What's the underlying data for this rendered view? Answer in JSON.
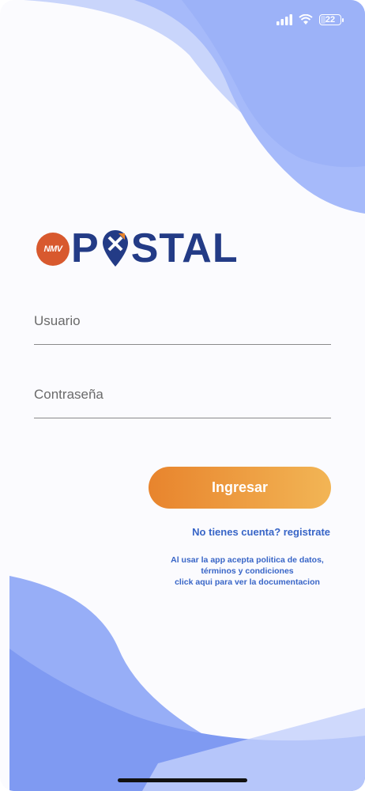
{
  "status_bar": {
    "battery": "22",
    "icons": [
      "signal-icon",
      "wifi-icon",
      "battery-icon"
    ]
  },
  "logo": {
    "badge_text": "NMV",
    "word_first": "P",
    "word_rest": "STAL"
  },
  "form": {
    "username_placeholder": "Usuario",
    "password_placeholder": "Contraseña",
    "login_label": "Ingresar"
  },
  "links": {
    "register": "No tienes cuenta? registrate",
    "legal_line1": "Al usar la app acepta politica de datos,",
    "legal_line2": "términos y condiciones",
    "legal_line3": "click aqui para ver la documentacion"
  },
  "colors": {
    "brand_blue": "#233b86",
    "accent_orange": "#e8842d",
    "link_blue": "#3865c7",
    "wave_blue": "#8aa4f4",
    "badge_red": "#d8592e"
  }
}
